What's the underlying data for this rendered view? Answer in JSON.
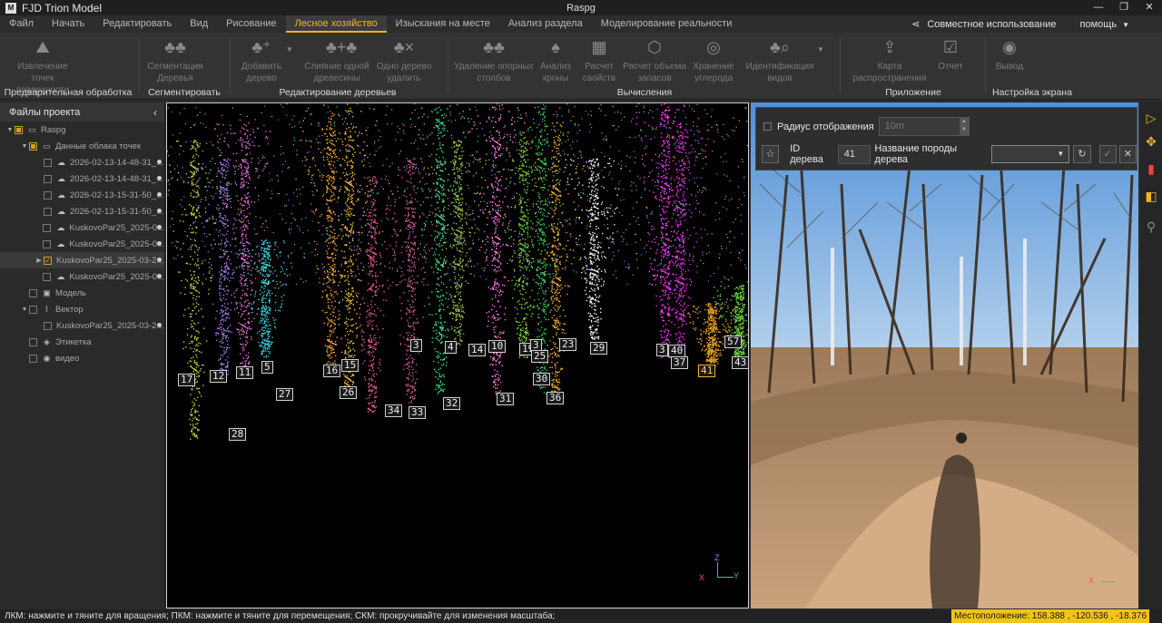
{
  "app": {
    "name": "FJD Trion Model",
    "window_title": "Raspg",
    "logo_letter": "M"
  },
  "menu": {
    "items": [
      {
        "label": "Файл"
      },
      {
        "label": "Начать"
      },
      {
        "label": "Редактировать"
      },
      {
        "label": "Вид"
      },
      {
        "label": "Рисование"
      },
      {
        "label": "Лесное хозяйство",
        "active": true
      },
      {
        "label": "Изыскания на месте"
      },
      {
        "label": "Анализ раздела"
      },
      {
        "label": "Моделирование реальности"
      }
    ],
    "share_label": "Совместное использование",
    "help_label": "помощь"
  },
  "ribbon": {
    "tools": {
      "extract_ground": "Извлечение точек поверхности",
      "segment_trees": "Сегментация Деревья",
      "add_tree": "Добавить дерево",
      "merge_tree": "Слияние одной древесины",
      "delete_tree": "Одно дерево удалить",
      "remove_poles": "Удаление опорных столбов",
      "crown_analysis": "Анализ кроны",
      "compute_properties": "Расчет свойств",
      "volume_calc": "Расчет объема запасов",
      "carbon_storage": "Хранение углерода",
      "species_id": "Идентификация видов",
      "distribution_map": "Карта распространения",
      "report": "Отчет",
      "output": "Вывод"
    },
    "groups": {
      "preprocessing": "Предварительная обработка",
      "segment": "Сегментировать",
      "tree_edit": "Редактирование деревьев",
      "calculations": "Вычисления",
      "application": "Приложение",
      "screen_settings": "Настройка экрана"
    }
  },
  "project_panel": {
    "title": "Файлы проекта",
    "items": [
      {
        "label": "Raspg",
        "level": 0,
        "expander": "▼",
        "check": "partial",
        "icon": "folder-icon"
      },
      {
        "label": "Данные облака точек",
        "level": 1,
        "expander": "▼",
        "check": "partial",
        "icon": "folder-icon"
      },
      {
        "label": "2026-02-13-14-48-31_...",
        "level": 2,
        "check": "none",
        "icon": "cloud-icon",
        "dot": true
      },
      {
        "label": "2026-02-13-14-48-31_...",
        "level": 2,
        "check": "none",
        "icon": "cloud-icon",
        "dot": true
      },
      {
        "label": "2026-02-13-15-31-50_...",
        "level": 2,
        "check": "none",
        "icon": "cloud-icon",
        "dot": true
      },
      {
        "label": "2026-02-13-15-31-50_...",
        "level": 2,
        "check": "none",
        "icon": "cloud-icon",
        "dot": true
      },
      {
        "label": "KuskovoPar25_2025-0...",
        "level": 2,
        "check": "none",
        "icon": "cloud-icon",
        "dot": true
      },
      {
        "label": "KuskovoPar25_2025-0...",
        "level": 2,
        "check": "none",
        "icon": "cloud-icon",
        "dot": true
      },
      {
        "label": "KuskovoPar25_2025-03-2...",
        "level": 2,
        "expander": "▶",
        "check": "checked",
        "selected": true,
        "dot": true
      },
      {
        "label": "KuskovoPar25_2025-0...",
        "level": 2,
        "check": "none",
        "icon": "cloud-icon",
        "dot": true
      },
      {
        "label": "Модель",
        "level": 1,
        "check": "none",
        "icon": "model-icon"
      },
      {
        "label": "Вектор",
        "level": 1,
        "expander": "▼",
        "check": "none",
        "icon": "vector-icon"
      },
      {
        "label": "KuskovoPar25_2025-03-2...",
        "level": 2,
        "check": "none",
        "dot": true
      },
      {
        "label": "Этикетка",
        "level": 1,
        "check": "none",
        "icon": "label-icon"
      },
      {
        "label": "видео",
        "level": 1,
        "check": "none",
        "icon": "video-icon"
      }
    ]
  },
  "viewport": {
    "tree_ids": [
      {
        "id": "17"
      },
      {
        "id": "12"
      },
      {
        "id": "11"
      },
      {
        "id": "5"
      },
      {
        "id": "27"
      },
      {
        "id": "28"
      },
      {
        "id": "16"
      },
      {
        "id": "15"
      },
      {
        "id": "26"
      },
      {
        "id": "34"
      },
      {
        "id": "33"
      },
      {
        "id": "3"
      },
      {
        "id": "4"
      },
      {
        "id": "14"
      },
      {
        "id": "32"
      },
      {
        "id": "10"
      },
      {
        "id": "31"
      },
      {
        "id": "19"
      },
      {
        "id": "3"
      },
      {
        "id": "25"
      },
      {
        "id": "30"
      },
      {
        "id": "23"
      },
      {
        "id": "36"
      },
      {
        "id": "29"
      },
      {
        "id": "3"
      },
      {
        "id": "40"
      },
      {
        "id": "37"
      },
      {
        "id": "41",
        "selected": true
      },
      {
        "id": "57"
      },
      {
        "id": "43"
      }
    ],
    "axis": {
      "x": "X",
      "y": "Y",
      "z": "Z"
    }
  },
  "photo_panel": {
    "display_radius_label": "Радиус отображения",
    "display_radius_value": "10m",
    "tree_id_label": "ID дерева",
    "tree_id_value": "41",
    "species_label": "Название породы дерева",
    "species_value": ""
  },
  "statusbar": {
    "hint": "ЛКМ: нажмите и тяните для вращения; ПКМ: нажмите и тяните для перемещения; СКМ: прокручивайте для изменения масштаба;",
    "location": "Местоположение: 158.388 , -120.536 , -18.376"
  },
  "colors": {
    "accent": "#f0b429",
    "status_yellow": "#f2c318"
  }
}
